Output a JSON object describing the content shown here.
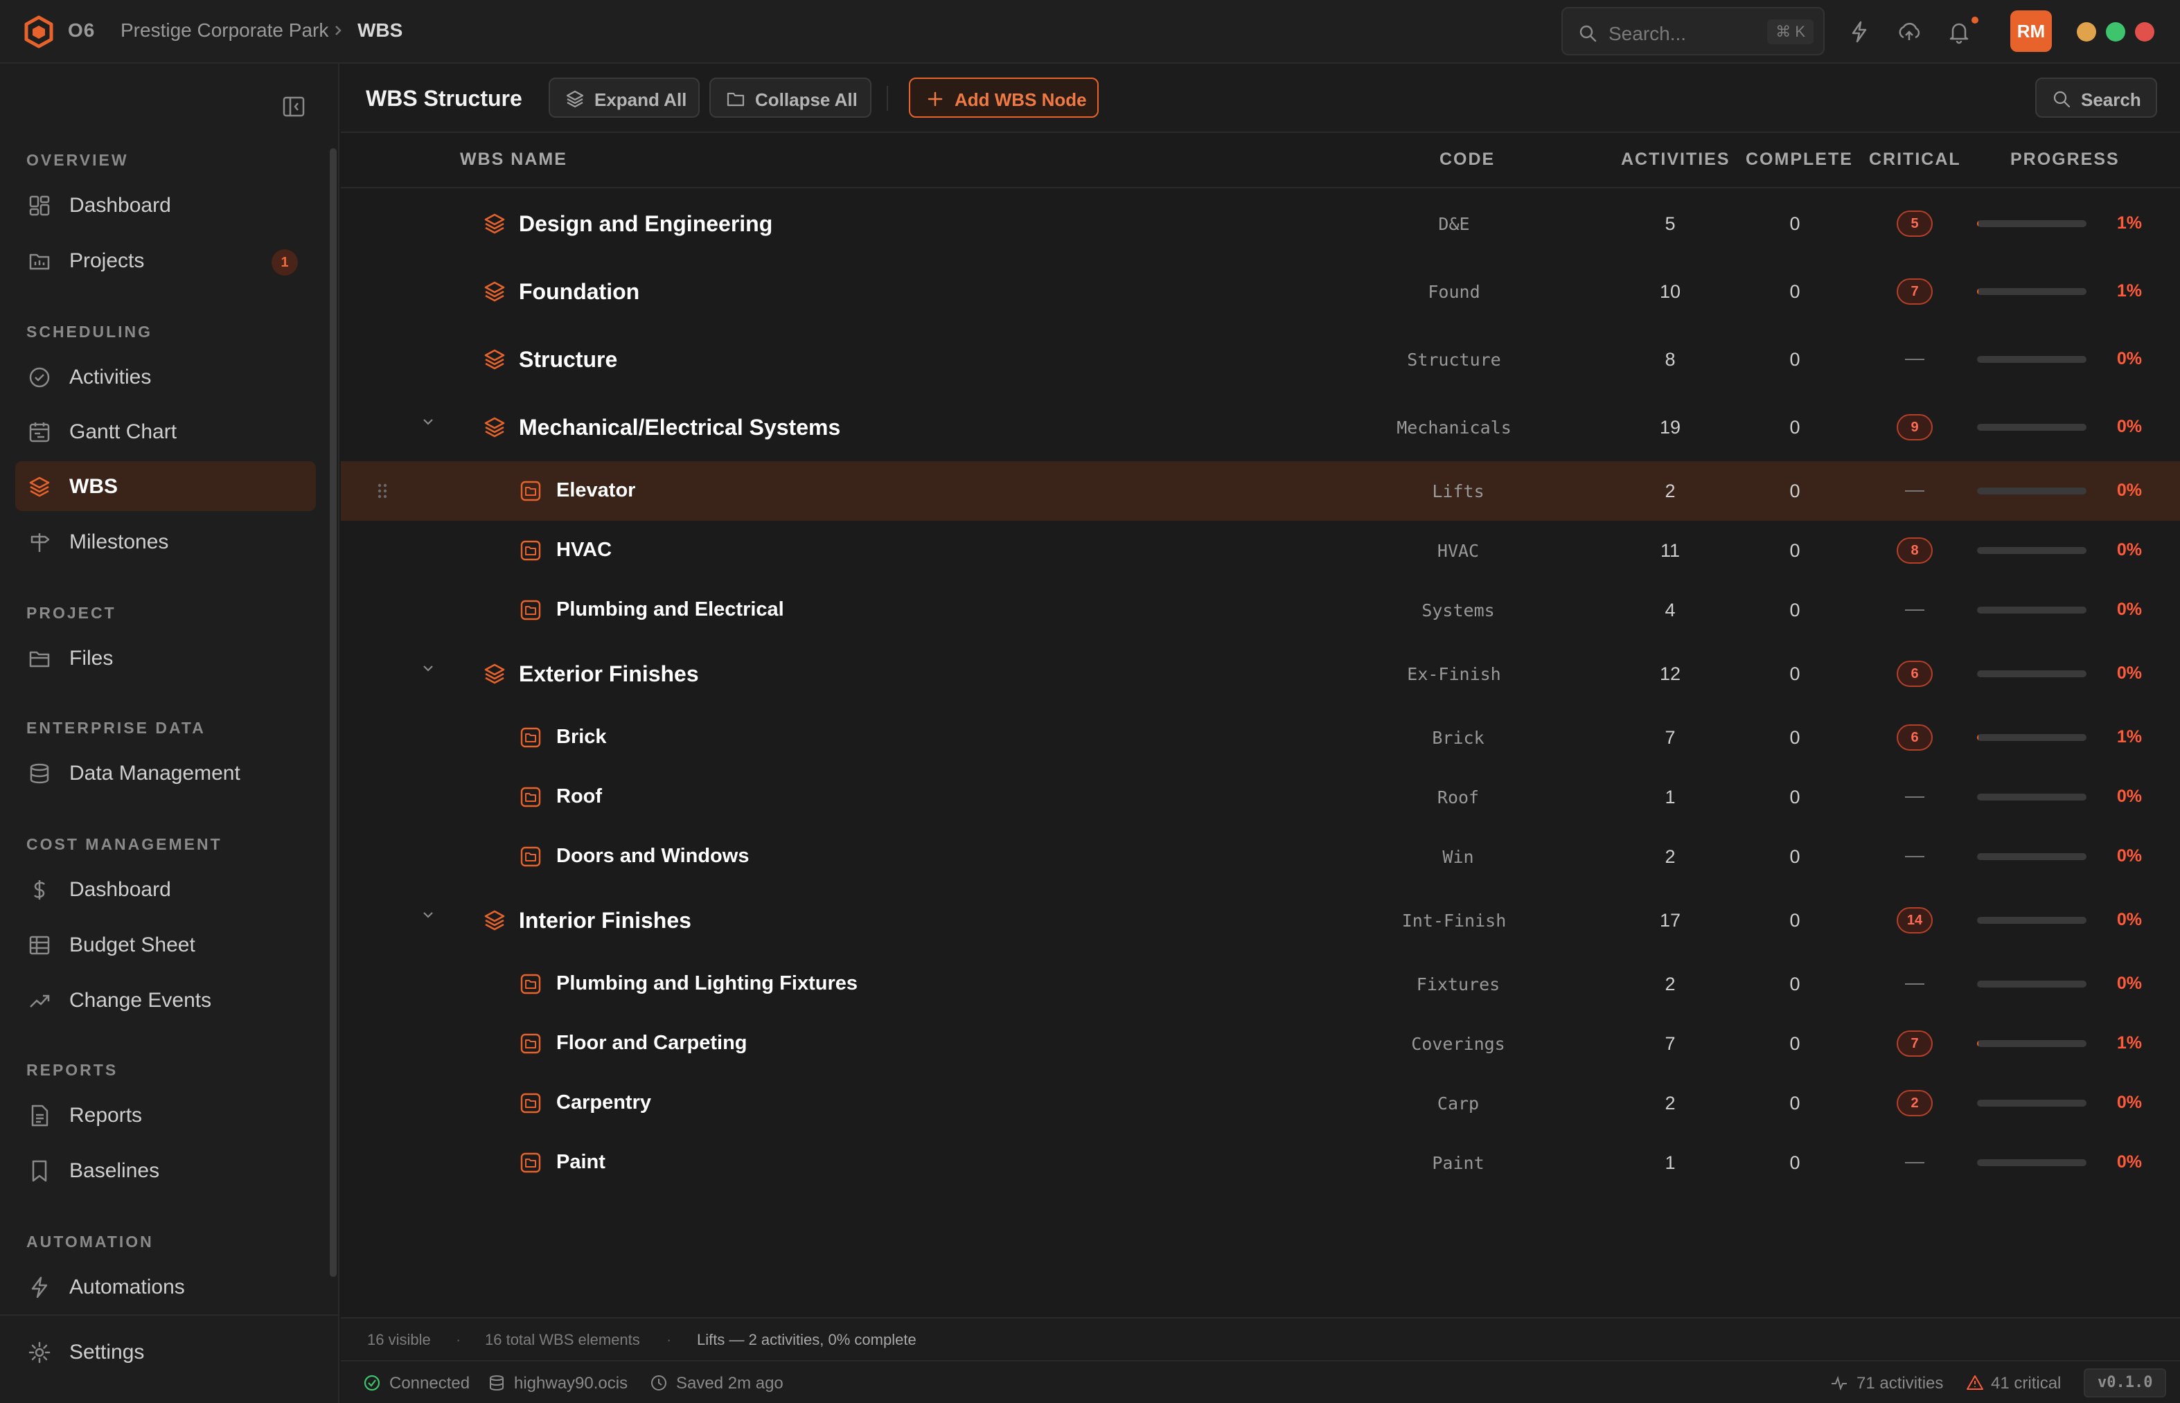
{
  "app": {
    "name": "O6"
  },
  "breadcrumb": {
    "project": "Prestige Corporate Park",
    "current": "WBS"
  },
  "search": {
    "placeholder": "Search...",
    "shortcut": "⌘ K"
  },
  "user": {
    "initials": "RM"
  },
  "window_controls": {
    "colors": [
      "#e0a24a",
      "#3ec46d",
      "#e2504c"
    ]
  },
  "sidebar": {
    "sections": [
      {
        "label": "OVERVIEW",
        "items": [
          {
            "label": "Dashboard",
            "icon": "dashboard-icon"
          },
          {
            "label": "Projects",
            "icon": "projects-icon",
            "badge": "1"
          }
        ]
      },
      {
        "label": "SCHEDULING",
        "items": [
          {
            "label": "Activities",
            "icon": "check-circle-icon"
          },
          {
            "label": "Gantt Chart",
            "icon": "calendar-icon"
          },
          {
            "label": "WBS",
            "icon": "layers-icon",
            "active": true
          },
          {
            "label": "Milestones",
            "icon": "signpost-icon"
          }
        ]
      },
      {
        "label": "PROJECT",
        "items": [
          {
            "label": "Files",
            "icon": "folder-icon"
          }
        ]
      },
      {
        "label": "ENTERPRISE DATA",
        "items": [
          {
            "label": "Data Management",
            "icon": "database-icon"
          }
        ]
      },
      {
        "label": "COST MANAGEMENT",
        "items": [
          {
            "label": "Dashboard",
            "icon": "dollar-icon"
          },
          {
            "label": "Budget Sheet",
            "icon": "table-icon"
          },
          {
            "label": "Change Events",
            "icon": "trend-icon"
          }
        ]
      },
      {
        "label": "REPORTS",
        "items": [
          {
            "label": "Reports",
            "icon": "report-icon"
          },
          {
            "label": "Baselines",
            "icon": "bookmark-icon"
          }
        ]
      },
      {
        "label": "AUTOMATION",
        "items": [
          {
            "label": "Automations",
            "icon": "bolt-icon"
          }
        ]
      }
    ],
    "settings_label": "Settings"
  },
  "toolbar": {
    "title": "WBS Structure",
    "expand_label": "Expand All",
    "collapse_label": "Collapse All",
    "add_label": "Add WBS Node",
    "search_label": "Search"
  },
  "table": {
    "columns": [
      "WBS NAME",
      "CODE",
      "ACTIVITIES",
      "COMPLETE",
      "CRITICAL",
      "PROGRESS"
    ],
    "rows": [
      {
        "name": "Design and Engineering",
        "code": "D&E",
        "activities": "5",
        "complete": "0",
        "critical": "5",
        "progress": "1%",
        "progress_value": 0.01,
        "level": 0,
        "expandable": false
      },
      {
        "name": "Foundation",
        "code": "Found",
        "activities": "10",
        "complete": "0",
        "critical": "7",
        "progress": "1%",
        "progress_value": 0.01,
        "level": 0,
        "expandable": false
      },
      {
        "name": "Structure",
        "code": "Structure",
        "activities": "8",
        "complete": "0",
        "critical": "",
        "progress": "0%",
        "progress_value": 0,
        "level": 0,
        "expandable": false
      },
      {
        "name": "Mechanical/Electrical Systems",
        "code": "Mechanicals",
        "activities": "19",
        "complete": "0",
        "critical": "9",
        "progress": "0%",
        "progress_value": 0,
        "level": 0,
        "expandable": true
      },
      {
        "name": "Elevator",
        "code": "Lifts",
        "activities": "2",
        "complete": "0",
        "critical": "",
        "progress": "0%",
        "progress_value": 0,
        "level": 1,
        "selected": true
      },
      {
        "name": "HVAC",
        "code": "HVAC",
        "activities": "11",
        "complete": "0",
        "critical": "8",
        "progress": "0%",
        "progress_value": 0,
        "level": 1
      },
      {
        "name": "Plumbing and Electrical",
        "code": "Systems",
        "activities": "4",
        "complete": "0",
        "critical": "",
        "progress": "0%",
        "progress_value": 0,
        "level": 1
      },
      {
        "name": "Exterior Finishes",
        "code": "Ex-Finish",
        "activities": "12",
        "complete": "0",
        "critical": "6",
        "progress": "0%",
        "progress_value": 0,
        "level": 0,
        "expandable": true
      },
      {
        "name": "Brick",
        "code": "Brick",
        "activities": "7",
        "complete": "0",
        "critical": "6",
        "progress": "1%",
        "progress_value": 0.01,
        "level": 1
      },
      {
        "name": "Roof",
        "code": "Roof",
        "activities": "1",
        "complete": "0",
        "critical": "",
        "progress": "0%",
        "progress_value": 0,
        "level": 1
      },
      {
        "name": "Doors and Windows",
        "code": "Win",
        "activities": "2",
        "complete": "0",
        "critical": "",
        "progress": "0%",
        "progress_value": 0,
        "level": 1
      },
      {
        "name": "Interior Finishes",
        "code": "Int-Finish",
        "activities": "17",
        "complete": "0",
        "critical": "14",
        "progress": "0%",
        "progress_value": 0,
        "level": 0,
        "expandable": true
      },
      {
        "name": "Plumbing and Lighting Fixtures",
        "code": "Fixtures",
        "activities": "2",
        "complete": "0",
        "critical": "",
        "progress": "0%",
        "progress_value": 0,
        "level": 1
      },
      {
        "name": "Floor and Carpeting",
        "code": "Coverings",
        "activities": "7",
        "complete": "0",
        "critical": "7",
        "progress": "1%",
        "progress_value": 0.01,
        "level": 1
      },
      {
        "name": "Carpentry",
        "code": "Carp",
        "activities": "2",
        "complete": "0",
        "critical": "2",
        "progress": "0%",
        "progress_value": 0,
        "level": 1
      },
      {
        "name": "Paint",
        "code": "Paint",
        "activities": "1",
        "complete": "0",
        "critical": "",
        "progress": "0%",
        "progress_value": 0,
        "level": 1
      }
    ]
  },
  "status": {
    "visible": "16 visible",
    "total": "16 total WBS elements",
    "selection": "Lifts — 2 activities, 0% complete"
  },
  "footer": {
    "connection": "Connected",
    "file": "highway90.ocis",
    "saved": "Saved 2m ago",
    "activities": "71 activities",
    "critical": "41 critical",
    "version": "v0.1.0"
  },
  "colors": {
    "accent": "#e8632b",
    "critical": "#ff5a3a",
    "selected_row": "#3a2419",
    "connected": "#3ec46d"
  }
}
